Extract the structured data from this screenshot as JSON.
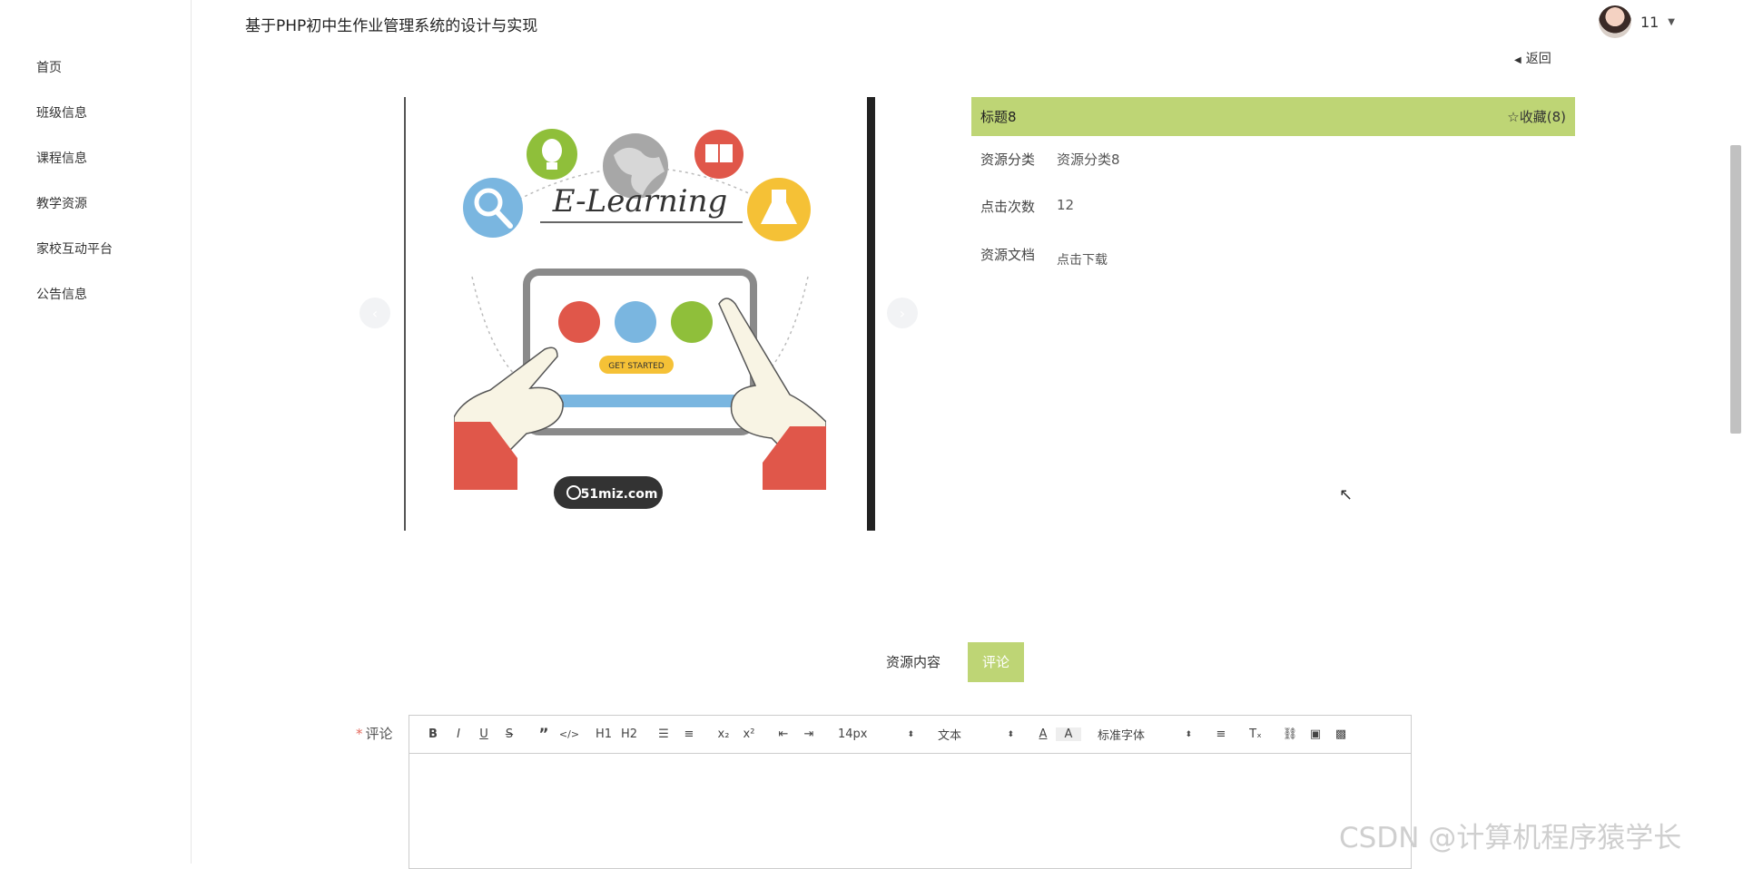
{
  "header": {
    "title": "基于PHP初中生作业管理系统的设计与实现",
    "username": "11"
  },
  "sidebar": {
    "items": [
      {
        "label": "首页"
      },
      {
        "label": "班级信息"
      },
      {
        "label": "课程信息"
      },
      {
        "label": "教学资源"
      },
      {
        "label": "家校互动平台"
      },
      {
        "label": "公告信息"
      }
    ]
  },
  "back_label": "返回",
  "illustration": {
    "title_text": "E-Learning",
    "button_text": "GET STARTED",
    "badge_text": "51miz.com"
  },
  "detail": {
    "title": "标题8",
    "favorite": "☆收藏(8)",
    "rows": [
      {
        "label": "资源分类",
        "value": "资源分类8"
      },
      {
        "label": "点击次数",
        "value": "12"
      },
      {
        "label": "资源文档",
        "value": "点击下载"
      }
    ]
  },
  "tabs": [
    {
      "label": "资源内容"
    },
    {
      "label": "评论"
    }
  ],
  "comment": {
    "required_mark": "*",
    "label": "评论",
    "toolbar": {
      "bold": "B",
      "italic": "I",
      "underline": "U",
      "strike": "S",
      "quote": "”",
      "code": "</>",
      "h1": "H1",
      "h2": "H2",
      "ordered_list": "☰",
      "bullet_list": "≡",
      "subscript": "x₂",
      "superscript": "x²",
      "outdent": "⇤",
      "indent": "⇥",
      "font_size": "14px",
      "text_type": "文本",
      "font_family": "标准字体",
      "align": "≡",
      "clear": "Tₓ",
      "link": "🔗",
      "image": "▣",
      "video": "▩"
    }
  },
  "watermark": "CSDN @计算机程序猿学长",
  "colors": {
    "accent": "#bed575",
    "link": "#2a7bc0"
  }
}
